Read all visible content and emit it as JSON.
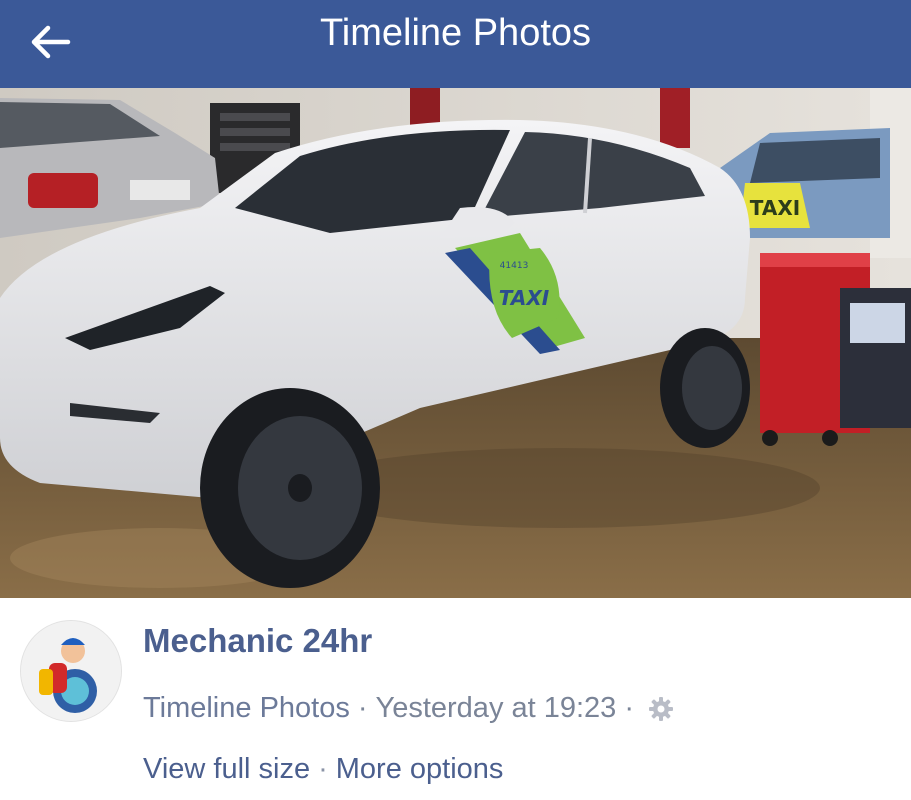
{
  "header": {
    "title": "Timeline Photos",
    "back_icon": "arrow-left-icon",
    "background": "#3b5998"
  },
  "photo": {
    "sign_text": "TAXI",
    "roof_sign_text": "TAXI",
    "badge_number": "41413"
  },
  "post": {
    "page_name": "Mechanic 24hr",
    "album_link": "Timeline Photos",
    "separator": "·",
    "timestamp": "Yesterday at 19:23",
    "privacy_icon": "gear-icon",
    "view_full_size": "View full size",
    "more_options": "More options"
  },
  "colors": {
    "link": "#4b5f8e",
    "meta": "#7a8497"
  }
}
